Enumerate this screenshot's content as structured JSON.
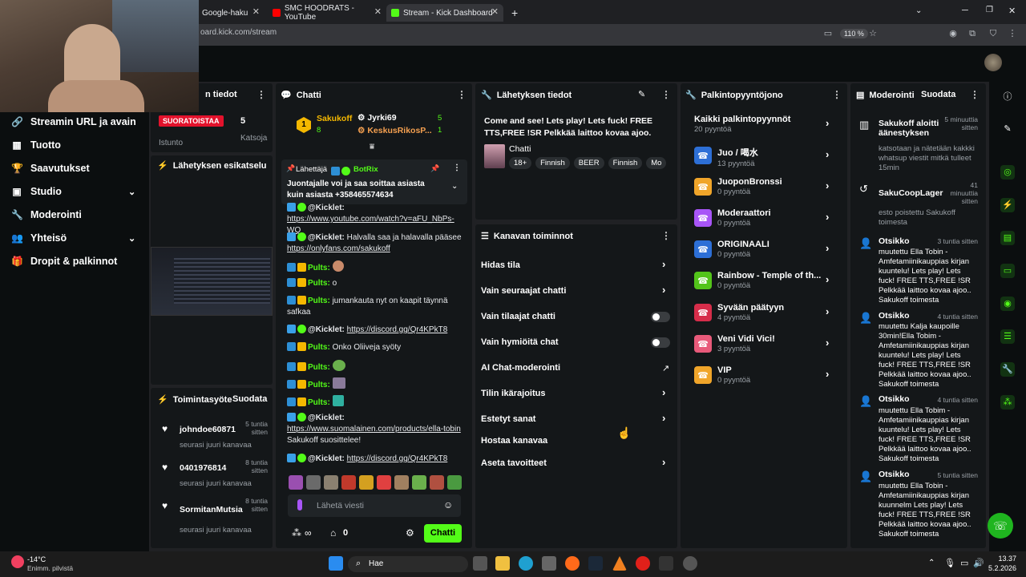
{
  "browser": {
    "tabs": [
      {
        "label": "Google-haku"
      },
      {
        "label": "SMC HOODRATS - YouTube"
      },
      {
        "label": "Stream - Kick Dashboard"
      }
    ],
    "url": "oard.kick.com/stream",
    "zoom": "110 %"
  },
  "sidebar": {
    "items": [
      {
        "label": "Streamin URL ja avain"
      },
      {
        "label": "Tuotto"
      },
      {
        "label": "Saavutukset"
      },
      {
        "label": "Studio"
      },
      {
        "label": "Moderointi"
      },
      {
        "label": "Yhteisö"
      },
      {
        "label": "Dropit & palkinnot"
      }
    ]
  },
  "stream_info": {
    "title_partial": "n tiedot",
    "live_badge": "SUORATOISTAA",
    "live_count": "5",
    "session_label": "Istunto",
    "viewers_label": "Katsoja",
    "preview_label": "Lähetyksen esikatselu"
  },
  "activity": {
    "title": "Toimintasyöte",
    "filter": "Suodata",
    "items": [
      {
        "user": "johndoe60871",
        "time": "5 tuntia sitten",
        "text": "seurasi juuri kanavaa"
      },
      {
        "user": "0401976814",
        "time": "8 tuntia sitten",
        "text": "seurasi juuri kanavaa"
      },
      {
        "user": "SormitanMutsia",
        "time": "8 tuntia sitten",
        "text": "seurasi juuri kanavaa"
      }
    ]
  },
  "chat": {
    "title": "Chatti",
    "top_gifters": [
      {
        "name": "Sakukoff",
        "count": "8",
        "rank": "1"
      },
      {
        "name": "Jyrki69",
        "count": "5"
      },
      {
        "name": "KeskusRikosP...",
        "count": "1"
      }
    ],
    "pinned_sender": "Lähettäjä",
    "pinned_user": "BotRix",
    "pinned_text": "Juontajalle voi ja saa soittaa asiasta kuin asiasta +358465574634",
    "messages": [
      {
        "user": "@Kicklet:",
        "text": "https://www.youtube.com/watch?v=aFU_NbPs-WQ",
        "link": true
      },
      {
        "user": "@Kicklet:",
        "text": "Halvalla saa ja halavalla pääsee ",
        "link_text": "https://onlyfans.com/sakukoff"
      },
      {
        "user": "Pults:",
        "text": ""
      },
      {
        "user": "Pults:",
        "text": "o"
      },
      {
        "user": "Pults:",
        "text": "jumankauta nyt on kaapit täynnä safkaa"
      },
      {
        "user": "@Kicklet:",
        "text": "https://discord.gg/Qr4KPkT8",
        "link": true
      },
      {
        "user": "Pults:",
        "text": "Onko Oliiveja syöty"
      },
      {
        "user": "Pults:",
        "text": ""
      },
      {
        "user": "Pults:",
        "text": ""
      },
      {
        "user": "Pults:",
        "text": ""
      },
      {
        "user": "@Kicklet:",
        "text": "https://www.suomalainen.com/products/ella-tobin",
        "suffix": "Sakukoff suosittelee!"
      },
      {
        "user": "@Kicklet:",
        "text": "https://discord.gg/Qr4KPkT8",
        "link": true
      }
    ],
    "input_placeholder": "Lähetä viesti",
    "points": "0",
    "send_label": "Chatti"
  },
  "broadcast": {
    "title": "Lähetyksen tiedot",
    "stream_title": "Come and see! Lets play! Lets fuck! FREE TTS,FREE !SR Pelkkää laittoo kovaa ajoo.",
    "category": "Chatti",
    "tags": [
      "18+",
      "Finnish",
      "BEER",
      "Finnish",
      "Mo"
    ]
  },
  "channel_actions": {
    "title": "Kanavan toiminnot",
    "items": [
      {
        "label": "Hidas tila",
        "control": "arrow"
      },
      {
        "label": "Vain seuraajat chatti",
        "control": "arrow"
      },
      {
        "label": "Vain tilaajat chatti",
        "control": "toggle"
      },
      {
        "label": "Vain hymiöitä chat",
        "control": "toggle"
      },
      {
        "label": "AI Chat-moderointi",
        "control": "external"
      },
      {
        "label": "Tilin ikärajoitus",
        "control": "arrow"
      },
      {
        "label": "Estetyt sanat",
        "control": "arrow"
      },
      {
        "label": "Hostaa kanavaa",
        "control": "none"
      },
      {
        "label": "Aseta tavoitteet",
        "control": "arrow"
      }
    ]
  },
  "rewards": {
    "title": "Palkintopyyntöjono",
    "all_label": "Kaikki palkintopyynnöt",
    "all_count": "20 pyyntöä",
    "items": [
      {
        "name": "Juo / 喝水",
        "count": "13 pyyntöä",
        "color": "#2d6fd6"
      },
      {
        "name": "JuoponBronssi",
        "count": "0 pyyntöä",
        "color": "#f0a52a"
      },
      {
        "name": "Moderaattori",
        "count": "0 pyyntöä",
        "color": "#a855f7"
      },
      {
        "name": "ORIGINAALI",
        "count": "0 pyyntöä",
        "color": "#2d6fd6"
      },
      {
        "name": "Rainbow - Temple of th...",
        "count": "0 pyyntöä",
        "color": "#53c41a"
      },
      {
        "name": "Syvään päätyyn",
        "count": "4 pyyntöä",
        "color": "#d62d4a"
      },
      {
        "name": "Veni Vidi Vici!",
        "count": "3 pyyntöä",
        "color": "#e85a7a"
      },
      {
        "name": "VIP",
        "count": "0 pyyntöä",
        "color": "#f0a52a"
      }
    ]
  },
  "moderation": {
    "title": "Moderointi",
    "filter": "Suodata",
    "items": [
      {
        "head": "Sakukoff aloitti äänestyksen",
        "time": "5 minuuttia sitten",
        "body": "katsotaan ja nätetään kakkki whatsup viestit mitkä tulleet 15min"
      },
      {
        "head": "SakuCoopLager",
        "time": "41 minuuttia sitten",
        "body": "esto poistettu Sakukoff toimesta"
      },
      {
        "head": "Otsikko",
        "time": "3 tuntia sitten",
        "body": "muutettu Ella Tobin - Amfetamiinikauppias kirjan kuuntelu! Lets play! Lets fuck! FREE TTS,FREE !SR Pelkkää laittoo kovaa ajoo.. Sakukoff toimesta"
      },
      {
        "head": "Otsikko",
        "time": "4 tuntia sitten",
        "body": "muutettu Kalja kaupoille 30min!Ella Tobim - Amfetamiinikauppias kirjan kuuntelu! Lets play! Lets fuck! FREE TTS,FREE !SR Pelkkää laittoo kovaa ajoo.. Sakukoff toimesta"
      },
      {
        "head": "Otsikko",
        "time": "4 tuntia sitten",
        "body": "muutettu Ella Tobim - Amfetamiinikauppias kirjan kuuntelu! Lets play! Lets fuck! FREE TTS,FREE !SR Pelkkää laittoo kovaa ajoo.. Sakukoff toimesta"
      },
      {
        "head": "Otsikko",
        "time": "5 tuntia sitten",
        "body": "muutettu Ella Tobin - Amfetamiinikauppias kirjan kuunnelm Lets play! Lets fuck! FREE TTS,FREE !SR Pelkkää laittoo kovaa ajoo.. Sakukoff toimesta"
      }
    ]
  },
  "taskbar": {
    "weather_temp": "-14°C",
    "weather_desc": "Enimm. pilvistä",
    "search": "Hae",
    "time": "13.37",
    "date": "5.2.2026"
  },
  "colors": {
    "accent": "#53fc18",
    "panel": "#141719",
    "bg": "#0b0e0f"
  }
}
